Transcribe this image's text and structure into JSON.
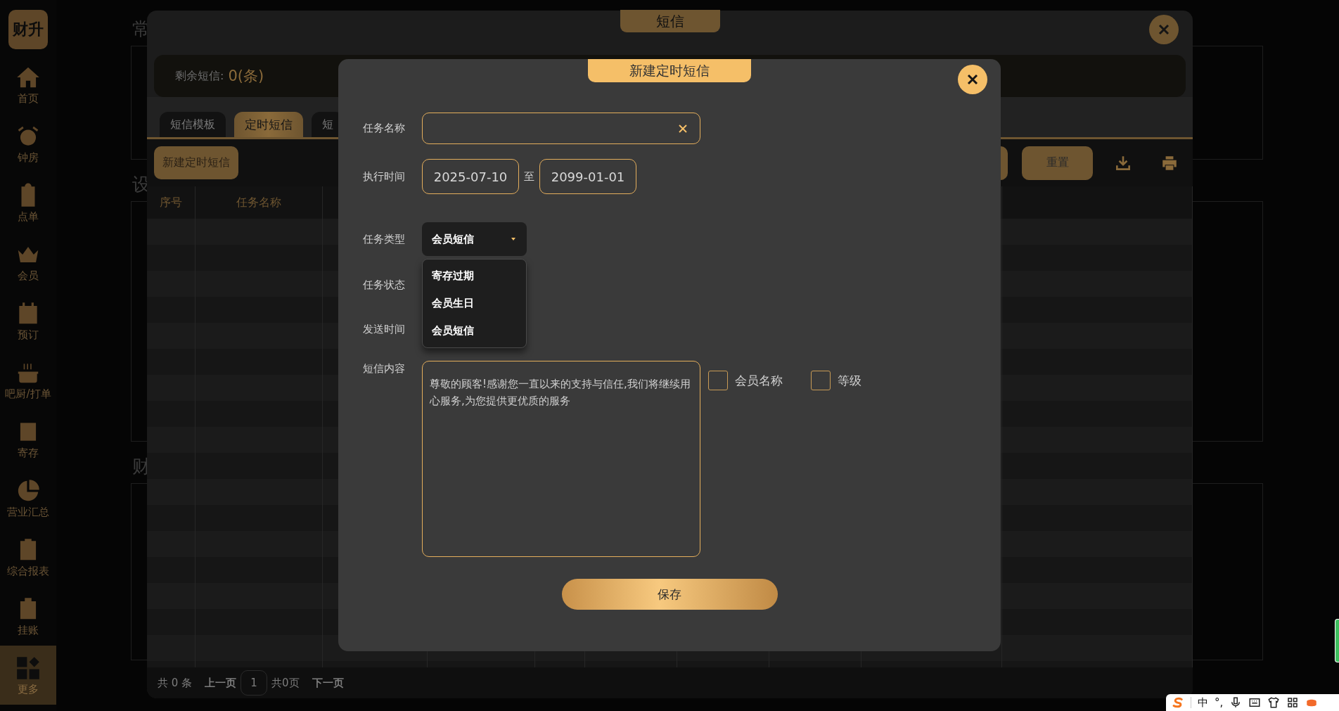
{
  "sidebar": {
    "logo": "财升",
    "items": [
      {
        "label": "首页",
        "selected": false
      },
      {
        "label": "钟房",
        "selected": false
      },
      {
        "label": "点单",
        "selected": false
      },
      {
        "label": "会员",
        "selected": false
      },
      {
        "label": "预订",
        "selected": false
      },
      {
        "label": "吧厨/打单",
        "selected": false
      },
      {
        "label": "寄存",
        "selected": false
      },
      {
        "label": "营业汇总",
        "selected": false
      },
      {
        "label": "综合报表",
        "selected": false
      },
      {
        "label": "挂账",
        "selected": false
      },
      {
        "label": "更多",
        "selected": true
      }
    ]
  },
  "page": {
    "section_titles": [
      "常",
      "设",
      "财"
    ]
  },
  "sms_dialog": {
    "title": "短信",
    "remaining_label": "剩余短信:",
    "remaining_value": "0(条)",
    "tabs": [
      {
        "label": "短信模板",
        "selected": false
      },
      {
        "label": "定时短信",
        "selected": true
      },
      {
        "label": "短",
        "selected": false
      }
    ],
    "new_button": "新建定时短信",
    "reset_button": "重置",
    "table": {
      "columns": [
        "序号",
        "任务名称"
      ]
    },
    "pagination": {
      "total": "共 0 条",
      "prev": "上一页",
      "page": "1",
      "page_count": "共0页",
      "next": "下一页"
    }
  },
  "new_task_dialog": {
    "title": "新建定时短信",
    "fields": [
      {
        "kind": "text",
        "label": "任务名称"
      },
      {
        "kind": "daterange",
        "label": "执行时间",
        "from": "2025-07-10",
        "separator": "至",
        "to": "2099-01-01"
      },
      {
        "kind": "select",
        "label": "任务类型",
        "value": "会员短信",
        "expanded": true,
        "options": [
          "寄存过期",
          "会员生日",
          "会员短信"
        ]
      },
      {
        "kind": "covered",
        "label": "任务状态"
      },
      {
        "kind": "covered",
        "label": "发送时间"
      },
      {
        "kind": "textarea",
        "label": "短信内容",
        "value": "尊敬的顾客!感谢您一直以来的支持与信任,我们将继续用心服务,为您提供更优质的服务",
        "checkboxes": [
          {
            "label": "会员名称",
            "checked": false
          },
          {
            "label": "等级",
            "checked": false
          }
        ]
      }
    ],
    "save_button": "保存"
  },
  "ime_bar": {
    "items": [
      "中",
      "°,"
    ]
  }
}
